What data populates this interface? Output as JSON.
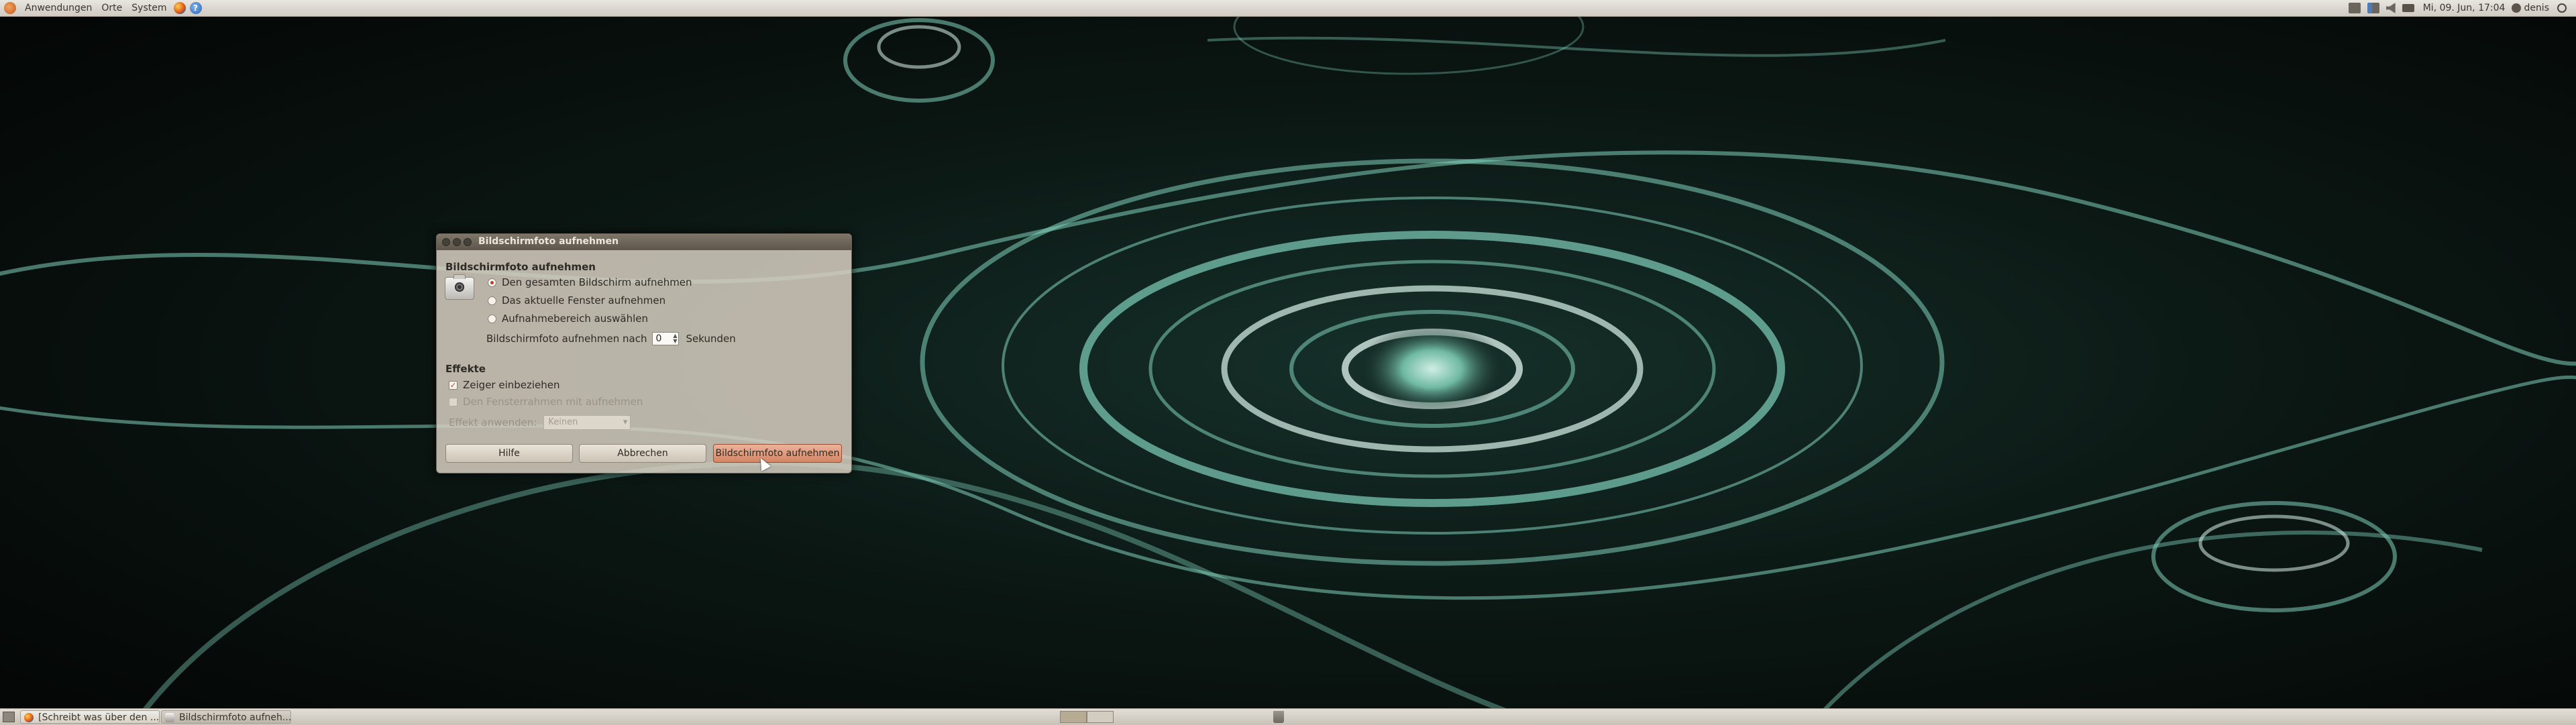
{
  "top_panel": {
    "menu": [
      "Anwendungen",
      "Orte",
      "System"
    ],
    "clock": "Mi, 09. Jun, 17:04",
    "user": "denis"
  },
  "dialog": {
    "title": "Bildschirmfoto aufnehmen",
    "section_capture": "Bildschirmfoto aufnehmen",
    "options": [
      "Den gesamten Bildschirm aufnehmen",
      "Das aktuelle Fenster aufnehmen",
      "Aufnahmebereich auswählen"
    ],
    "selected_option": 0,
    "delay_label": "Bildschirmfoto aufnehmen nach",
    "delay_value": "0",
    "delay_unit": "Sekunden",
    "section_effects": "Effekte",
    "include_pointer": "Zeiger einbeziehen",
    "include_border": "Den Fensterrahmen mit aufnehmen",
    "apply_effect_label": "Effekt anwenden:",
    "apply_effect_value": "Keinen",
    "buttons": {
      "help": "Hilfe",
      "cancel": "Abbrechen",
      "capture": "Bildschirmfoto aufnehmen"
    }
  },
  "taskbar": {
    "tasks": [
      "[Schreibt was über den ...",
      "Bildschirmfoto aufneh..."
    ]
  },
  "colors": {
    "accent": "#c43c1a",
    "wallpaper_base": "#070b09",
    "wallpaper_glow": "#8fd6c4"
  }
}
